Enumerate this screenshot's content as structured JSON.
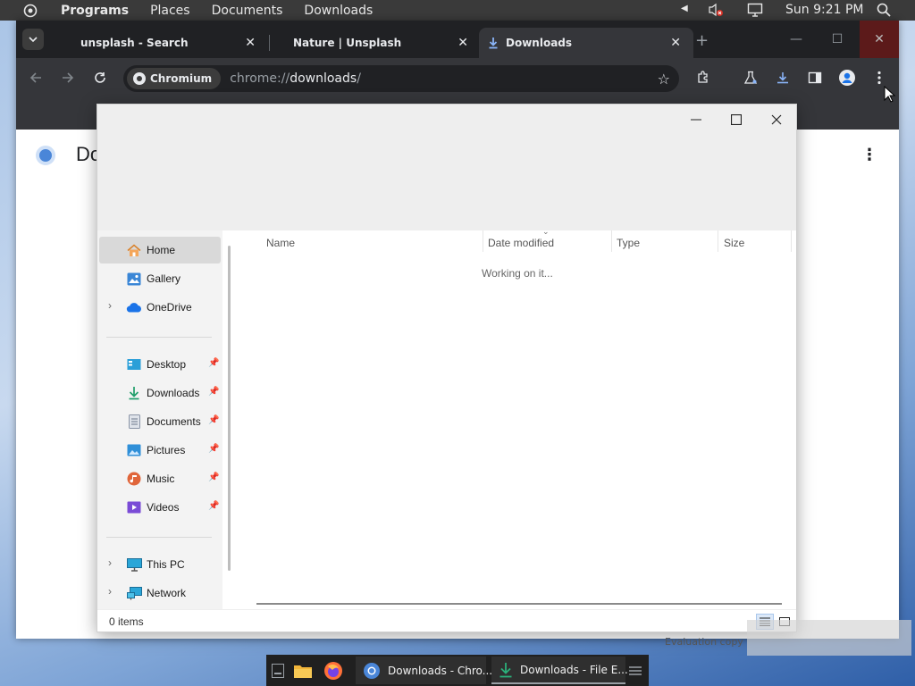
{
  "system_bar": {
    "menus": [
      "Programs",
      "Places",
      "Documents",
      "Downloads"
    ],
    "clock": "Sun 9:21 PM"
  },
  "browser": {
    "tabs": [
      {
        "label": "unsplash - Search"
      },
      {
        "label": "Nature | Unsplash"
      },
      {
        "label": "Downloads"
      }
    ],
    "omnibox": {
      "chip": "Chromium",
      "url_scheme": "chrome://",
      "url_host": "downloads",
      "url_tail": "/"
    },
    "page": {
      "title": "Do"
    }
  },
  "explorer": {
    "nav": {
      "items_top": [
        {
          "label": "Home",
          "icon": "home-icon"
        },
        {
          "label": "Gallery",
          "icon": "gallery-icon"
        },
        {
          "label": "OneDrive",
          "icon": "cloud-icon"
        }
      ],
      "items_quick": [
        {
          "label": "Desktop",
          "icon": "desktop-icon"
        },
        {
          "label": "Downloads",
          "icon": "download-icon"
        },
        {
          "label": "Documents",
          "icon": "document-icon"
        },
        {
          "label": "Pictures",
          "icon": "picture-icon"
        },
        {
          "label": "Music",
          "icon": "music-icon"
        },
        {
          "label": "Videos",
          "icon": "video-icon"
        }
      ],
      "items_bottom": [
        {
          "label": "This PC",
          "icon": "computer-icon"
        },
        {
          "label": "Network",
          "icon": "network-icon"
        }
      ]
    },
    "columns": [
      "Name",
      "Date modified",
      "Type",
      "Size"
    ],
    "loading_text": "Working on it...",
    "status": "0 items"
  },
  "taskbar": {
    "items": [
      {
        "label": "Downloads - Chro..."
      },
      {
        "label": "Downloads - File E..."
      }
    ],
    "watermark": "Evaluation copy"
  },
  "colors": {
    "accent": "#1a73e8",
    "chrome_dark": "#202124",
    "chrome_toolbar": "#35363a"
  }
}
